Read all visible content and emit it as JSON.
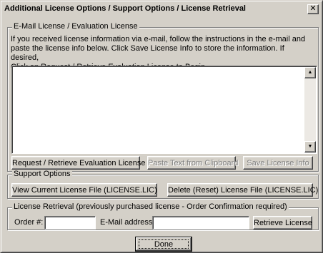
{
  "window": {
    "title": "Additional License Options / Support Options / License Retrieval",
    "close_glyph": "✕"
  },
  "email_section": {
    "legend": "E-Mail License / Evaluation License",
    "info_lines": [
      "If you received license information via e-mail, follow the instructions in the e-mail and",
      "paste the license info below. Click Save License Info to store the information.  If desired,",
      "Click on Request / Retrieve Evaluation License to Begin."
    ],
    "license_text": "",
    "scroll_up_glyph": "▲",
    "scroll_down_glyph": "▼",
    "buttons": {
      "request": "Request / Retrieve Evaluation License",
      "paste": "Paste Text from Clipboard",
      "save": "Save License Info"
    }
  },
  "support_section": {
    "legend": "Support Options",
    "buttons": {
      "view": "View Current License File (LICENSE.LIC)",
      "delete": "Delete (Reset) License File (LICENSE.LIC)"
    }
  },
  "retrieval_section": {
    "legend": "License Retrieval (previously purchased license - Order Confirmation required)",
    "order_label": "Order #:",
    "order_value": "",
    "email_label": "E-Mail address:",
    "email_value": "",
    "retrieve_button": "Retrieve License"
  },
  "done_button": "Done"
}
